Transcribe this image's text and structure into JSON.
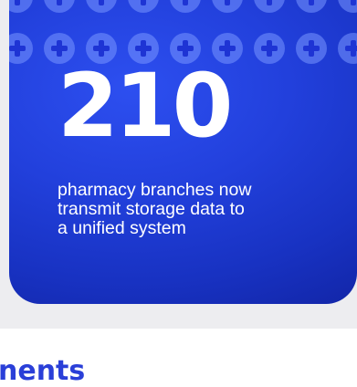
{
  "stat_card": {
    "number": "210",
    "caption_lines": [
      "pharmacy branches now",
      "transmit storage data to",
      "a unified system"
    ],
    "icon": "medical-cross-icon",
    "accent_color": "#2240dc"
  },
  "next_section": {
    "heading_fragment": "nents"
  }
}
